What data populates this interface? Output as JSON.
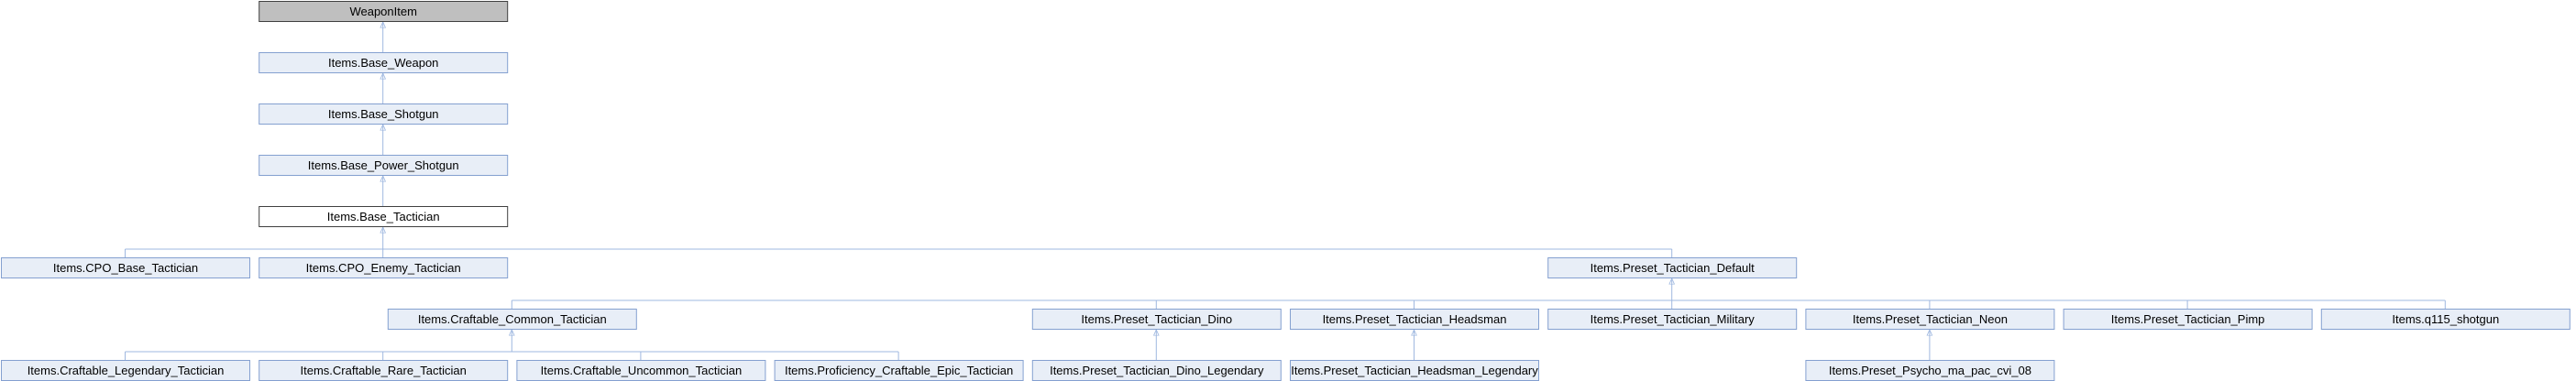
{
  "diagram": {
    "type": "class-inheritance-graph",
    "colors": {
      "node_fill": "#E8EEF7",
      "node_border": "#84A0D0",
      "root_fill": "#BFBFBF",
      "root_border": "#404040",
      "current_fill": "#FFFFFF",
      "current_border": "#404040",
      "edge": "#9FB8E0",
      "text": "#000000"
    },
    "nodes": [
      {
        "id": "weaponitem",
        "label": "WeaponItem",
        "style": "root"
      },
      {
        "id": "base-weapon",
        "label": "Items.Base_Weapon"
      },
      {
        "id": "base-shotgun",
        "label": "Items.Base_Shotgun"
      },
      {
        "id": "base-power-shotgun",
        "label": "Items.Base_Power_Shotgun"
      },
      {
        "id": "base-tactician",
        "label": "Items.Base_Tactician",
        "style": "current"
      },
      {
        "id": "cpo-base-tactician",
        "label": "Items.CPO_Base_Tactician"
      },
      {
        "id": "cpo-enemy-tactician",
        "label": "Items.CPO_Enemy_Tactician"
      },
      {
        "id": "preset-tactician-default",
        "label": "Items.Preset_Tactician_Default"
      },
      {
        "id": "craftable-common-tactician",
        "label": "Items.Craftable_Common_Tactician"
      },
      {
        "id": "preset-tactician-dino",
        "label": "Items.Preset_Tactician_Dino"
      },
      {
        "id": "preset-tactician-headsman",
        "label": "Items.Preset_Tactician_Headsman"
      },
      {
        "id": "preset-tactician-military",
        "label": "Items.Preset_Tactician_Military"
      },
      {
        "id": "preset-tactician-neon",
        "label": "Items.Preset_Tactician_Neon"
      },
      {
        "id": "preset-tactician-pimp",
        "label": "Items.Preset_Tactician_Pimp"
      },
      {
        "id": "q115-shotgun",
        "label": "Items.q115_shotgun"
      },
      {
        "id": "craftable-legendary-tactician",
        "label": "Items.Craftable_Legendary_Tactician"
      },
      {
        "id": "craftable-rare-tactician",
        "label": "Items.Craftable_Rare_Tactician"
      },
      {
        "id": "craftable-uncommon-tactician",
        "label": "Items.Craftable_Uncommon_Tactician"
      },
      {
        "id": "proficiency-craftable-epic-tactician",
        "label": "Items.Proficiency_Craftable_Epic_Tactician"
      },
      {
        "id": "preset-tactician-dino-legendary",
        "label": "Items.Preset_Tactician_Dino_Legendary"
      },
      {
        "id": "preset-tactician-headsman-legendary",
        "label": "Items.Preset_Tactician_Headsman_Legendary"
      },
      {
        "id": "preset-psycho-ma-pac-cvi-08",
        "label": "Items.Preset_Psycho_ma_pac_cvi_08"
      }
    ],
    "edges": [
      {
        "parent": "weaponitem",
        "child": "base-weapon"
      },
      {
        "parent": "base-weapon",
        "child": "base-shotgun"
      },
      {
        "parent": "base-shotgun",
        "child": "base-power-shotgun"
      },
      {
        "parent": "base-power-shotgun",
        "child": "base-tactician"
      },
      {
        "parent": "base-tactician",
        "child": "cpo-base-tactician"
      },
      {
        "parent": "base-tactician",
        "child": "cpo-enemy-tactician"
      },
      {
        "parent": "base-tactician",
        "child": "preset-tactician-default"
      },
      {
        "parent": "preset-tactician-default",
        "child": "craftable-common-tactician"
      },
      {
        "parent": "preset-tactician-default",
        "child": "preset-tactician-dino"
      },
      {
        "parent": "preset-tactician-default",
        "child": "preset-tactician-headsman"
      },
      {
        "parent": "preset-tactician-default",
        "child": "preset-tactician-military"
      },
      {
        "parent": "preset-tactician-default",
        "child": "preset-tactician-neon"
      },
      {
        "parent": "preset-tactician-default",
        "child": "preset-tactician-pimp"
      },
      {
        "parent": "preset-tactician-default",
        "child": "q115-shotgun"
      },
      {
        "parent": "craftable-common-tactician",
        "child": "craftable-legendary-tactician"
      },
      {
        "parent": "craftable-common-tactician",
        "child": "craftable-rare-tactician"
      },
      {
        "parent": "craftable-common-tactician",
        "child": "craftable-uncommon-tactician"
      },
      {
        "parent": "craftable-common-tactician",
        "child": "proficiency-craftable-epic-tactician"
      },
      {
        "parent": "preset-tactician-dino",
        "child": "preset-tactician-dino-legendary"
      },
      {
        "parent": "preset-tactician-headsman",
        "child": "preset-tactician-headsman-legendary"
      },
      {
        "parent": "preset-tactician-neon",
        "child": "preset-psycho-ma-pac-cvi-08"
      }
    ]
  }
}
